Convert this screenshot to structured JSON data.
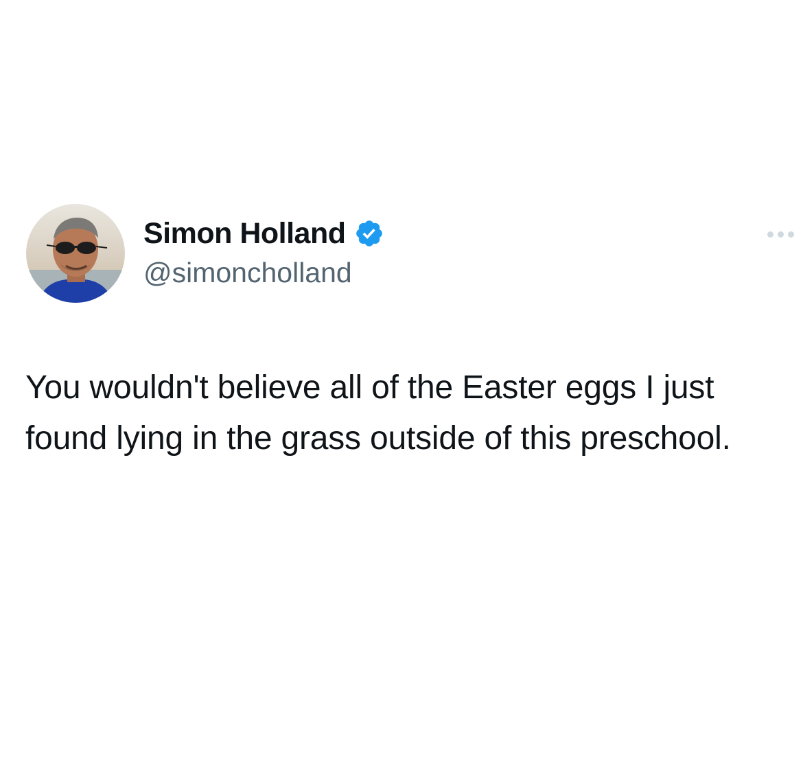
{
  "tweet": {
    "author": {
      "display_name": "Simon Holland",
      "handle": "@simoncholland",
      "verified": true
    },
    "text": "You wouldn't believe all of the Easter eggs I just found lying in the grass outside of this preschool.",
    "icons": {
      "verified": "verified-badge-icon",
      "more": "more-options-icon"
    }
  },
  "colors": {
    "background": "#ffffff",
    "text_primary": "#0f1419",
    "text_secondary": "#536471",
    "verified_blue": "#1d9bf0"
  }
}
